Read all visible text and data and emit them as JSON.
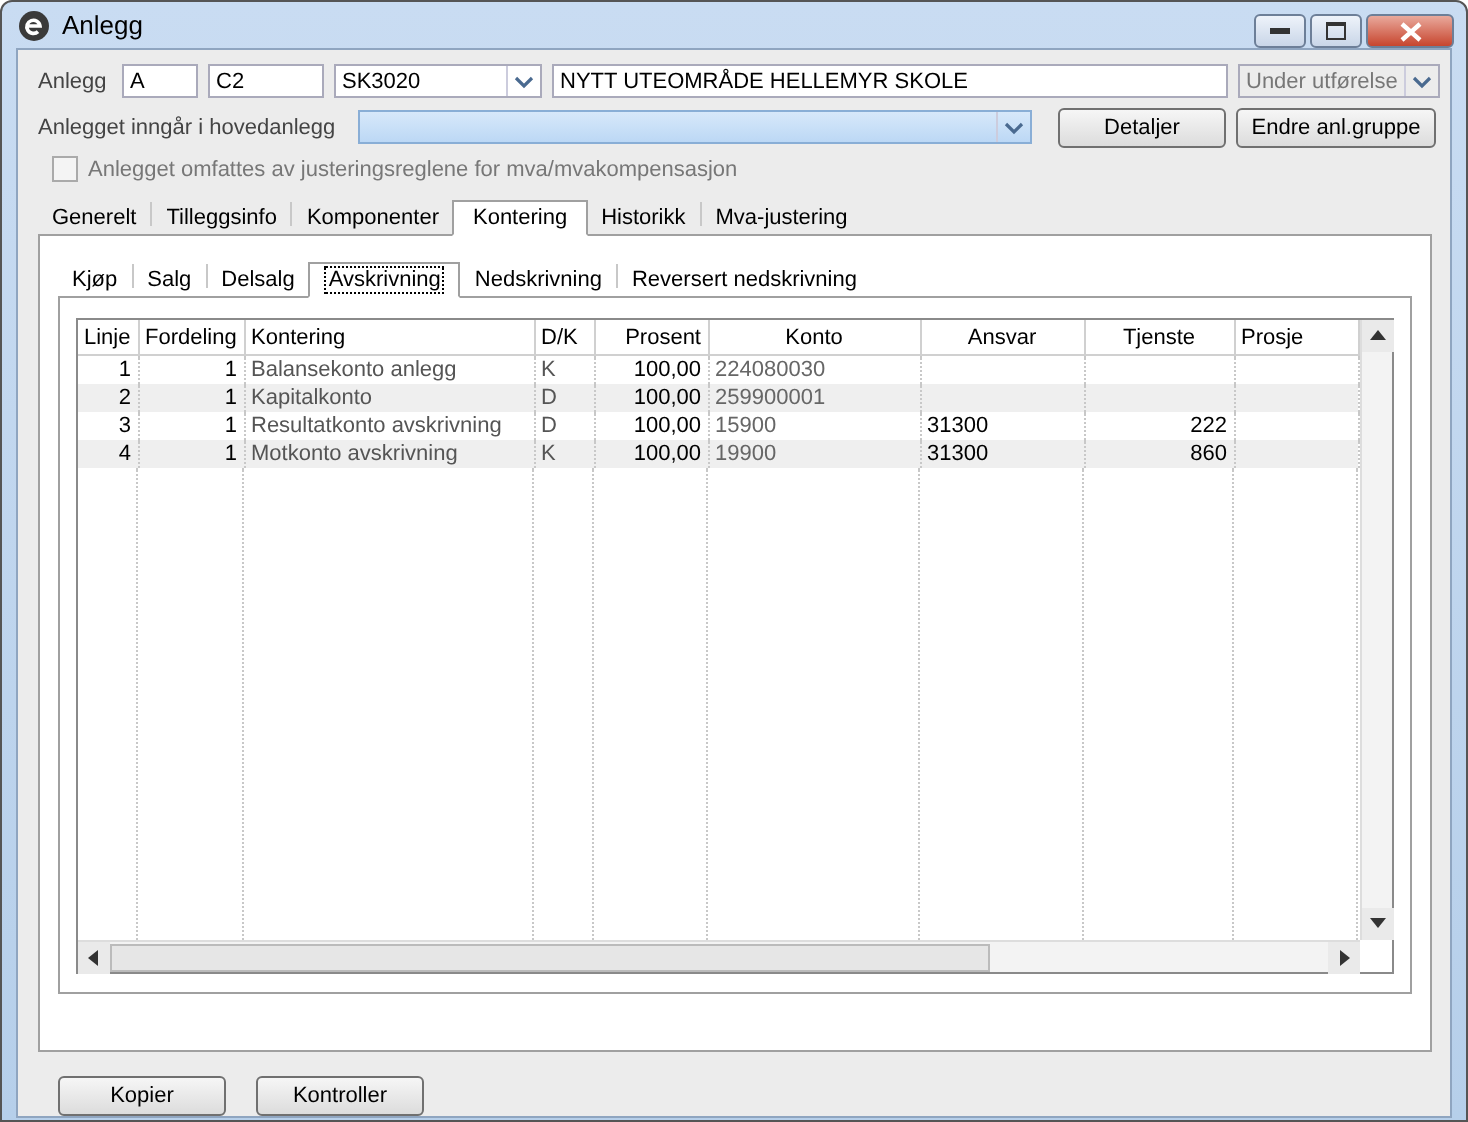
{
  "window": {
    "title": "Anlegg"
  },
  "header": {
    "anlegg_label": "Anlegg",
    "field_1": "A",
    "field_2": "C2",
    "group": "SK3020",
    "name": "NYTT UTEOMRÅDE HELLEMYR SKOLE",
    "status": {
      "value": "Under utførelse",
      "disabled": true
    },
    "hovedanlegg_label": "Anlegget inngår i hovedanlegg",
    "details_button": "Detaljer",
    "change_group_button": "Endre anl.gruppe",
    "mva_checkbox": {
      "label": "Anlegget omfattes av justeringsreglene for mva/mvakompensasjon",
      "checked": false,
      "disabled": true
    }
  },
  "tabs": [
    {
      "label": "Generelt",
      "selected": false
    },
    {
      "label": "Tilleggsinfo",
      "selected": false
    },
    {
      "label": "Komponenter",
      "selected": false
    },
    {
      "label": "Kontering",
      "selected": true
    },
    {
      "label": "Historikk",
      "selected": false
    },
    {
      "label": "Mva-justering",
      "selected": false
    }
  ],
  "subtabs": [
    {
      "label": "Kjøp",
      "selected": false
    },
    {
      "label": "Salg",
      "selected": false
    },
    {
      "label": "Delsalg",
      "selected": false
    },
    {
      "label": "Avskrivning",
      "selected": true
    },
    {
      "label": "Nedskrivning",
      "selected": false
    },
    {
      "label": "Reversert nedskrivning",
      "selected": false
    }
  ],
  "table": {
    "columns": [
      "Linje",
      "Fordeling",
      "Kontering",
      "D/K",
      "Prosent",
      "Konto",
      "Ansvar",
      "Tjenste",
      "Prosje"
    ],
    "rows": [
      [
        "1",
        "1",
        "Balansekonto anlegg",
        "K",
        "100,00",
        "224080030",
        null,
        null,
        null
      ],
      [
        "2",
        "1",
        "Kapitalkonto",
        "D",
        "100,00",
        "259900001",
        null,
        null,
        null
      ],
      [
        "3",
        "1",
        "Resultatkonto avskrivning",
        "D",
        "100,00",
        "15900",
        "31300",
        "222",
        null
      ],
      [
        "4",
        "1",
        "Motkonto avskrivning",
        "K",
        "100,00",
        "19900",
        "31300",
        "860",
        null
      ]
    ]
  },
  "buttons": [
    "Kopier",
    "Kontroller"
  ]
}
